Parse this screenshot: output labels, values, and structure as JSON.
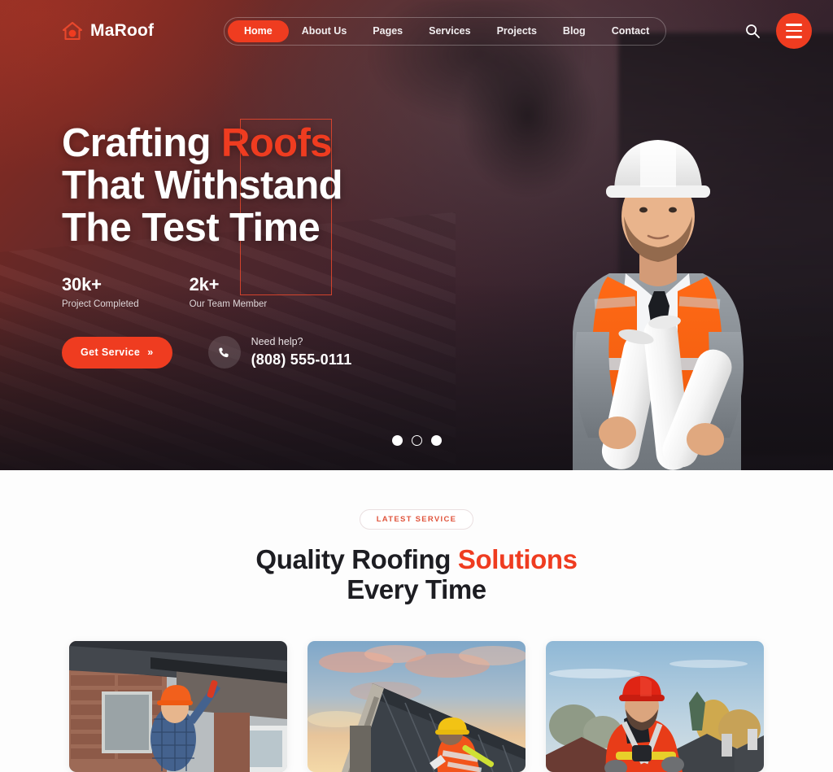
{
  "brand": {
    "name": "MaRoof",
    "logo_icon": "house-icon",
    "accent_color": "#ef3c20"
  },
  "nav": {
    "items": [
      {
        "label": "Home",
        "active": true
      },
      {
        "label": "About Us",
        "active": false
      },
      {
        "label": "Pages",
        "active": false
      },
      {
        "label": "Services",
        "active": false
      },
      {
        "label": "Projects",
        "active": false
      },
      {
        "label": "Blog",
        "active": false
      },
      {
        "label": "Contact",
        "active": false
      }
    ],
    "search_icon": "search-icon",
    "menu_icon": "hamburger-menu-icon"
  },
  "hero": {
    "title_line1_a": "Crafting ",
    "title_line1_b": "Roofs",
    "title_line2": "That Withstand",
    "title_line3": "The Test Time",
    "stats": [
      {
        "number": "30k+",
        "label": "Project Completed"
      },
      {
        "number": "2k+",
        "label": "Our Team Member"
      }
    ],
    "cta_label": "Get Service",
    "cta_arrow": "»",
    "phone_icon": "phone-icon",
    "need_help": "Need help?",
    "phone_number": "(808) 555-0111",
    "slider_dots": [
      "active",
      "inactive",
      "active"
    ]
  },
  "services": {
    "badge": "LATEST SERVICE",
    "title_a": "Quality Roofing ",
    "title_b": "Solutions",
    "title_line2": "Every Time",
    "cards": [
      {
        "alt": "worker-installing-gutter"
      },
      {
        "alt": "roofer-on-metal-roof-at-sunset"
      },
      {
        "alt": "roofer-with-harness-red-helmet"
      }
    ]
  }
}
